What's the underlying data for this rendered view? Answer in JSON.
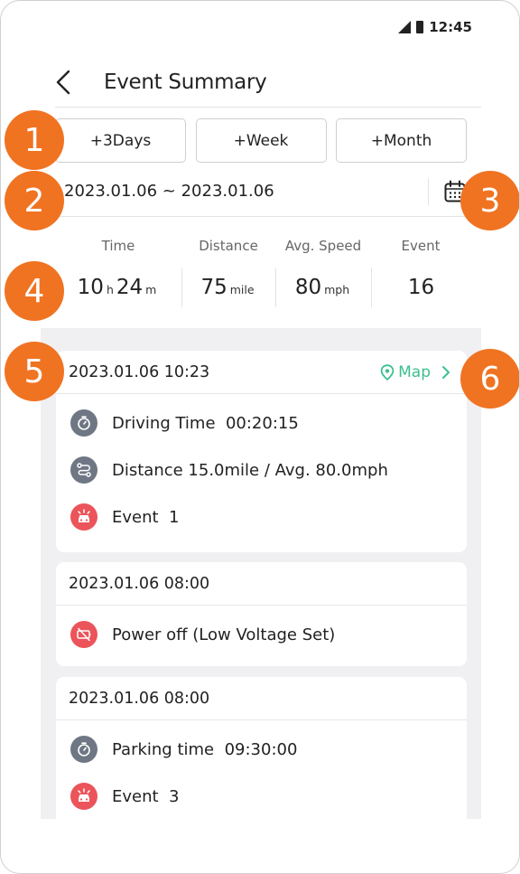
{
  "status_bar": {
    "time": "12:45",
    "icons": [
      "signal-icon",
      "battery-icon"
    ]
  },
  "header": {
    "title": "Event Summary"
  },
  "range_buttons": [
    "+3Days",
    "+Week",
    "+Month"
  ],
  "date_range": "2023.01.06 ~ 2023.01.06",
  "stats": {
    "labels": {
      "time": "Time",
      "distance": "Distance",
      "speed": "Avg. Speed",
      "event": "Event"
    },
    "time_hours": "10",
    "time_hours_unit": "h",
    "time_minutes": "24",
    "time_minutes_unit": "m",
    "distance": "75",
    "distance_unit": "mile",
    "speed": "80",
    "speed_unit": "mph",
    "events": "16"
  },
  "cards": [
    {
      "time": "2023.01.06 10:23",
      "map_label": "Map",
      "rows": [
        {
          "icon": "stopwatch-icon",
          "text": "Driving Time  00:20:15"
        },
        {
          "icon": "route-icon",
          "text": "Distance 15.0mile / Avg. 80.0mph"
        },
        {
          "icon": "car-event-icon",
          "text": "Event  1"
        }
      ]
    },
    {
      "time": "2023.01.06 08:00",
      "rows": [
        {
          "icon": "power-off-icon",
          "text": "Power off (Low Voltage Set)"
        }
      ]
    },
    {
      "time": "2023.01.06 08:00",
      "rows": [
        {
          "icon": "stopwatch-icon",
          "text": "Parking time  09:30:00"
        },
        {
          "icon": "car-event-icon",
          "text": "Event  3"
        }
      ]
    }
  ],
  "callouts": [
    "1",
    "2",
    "3",
    "4",
    "5",
    "6"
  ],
  "colors": {
    "callout": "#f07322",
    "map_link": "#3cc08f",
    "event_icon": "#eb545a",
    "info_icon": "#6f7784"
  }
}
